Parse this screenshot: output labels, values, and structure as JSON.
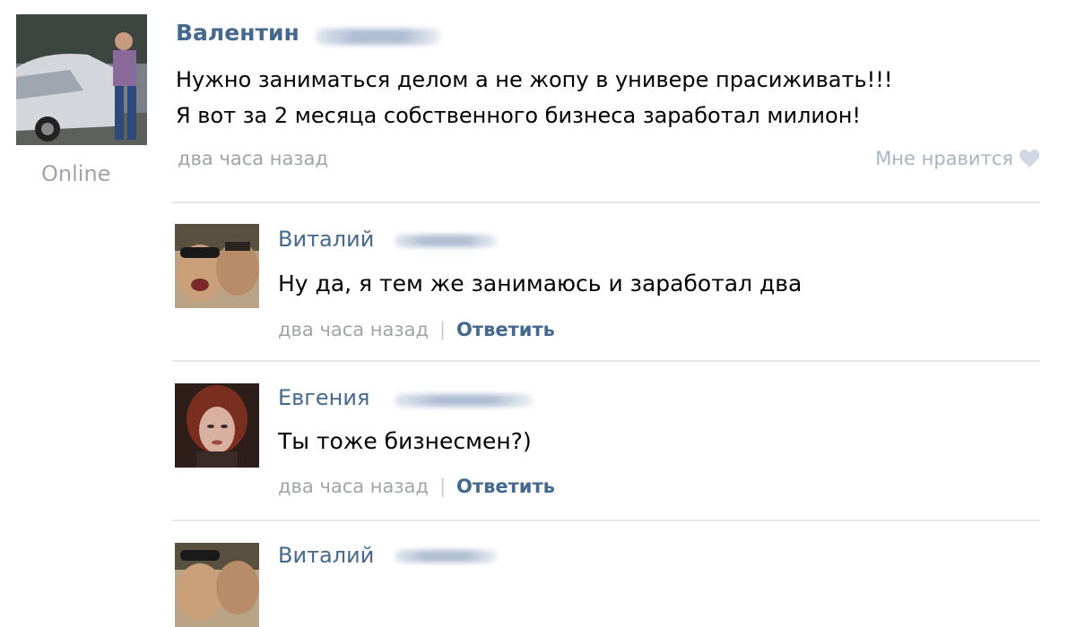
{
  "post": {
    "author": "Валентин",
    "status": "Online",
    "line1": "Нужно заниматься делом а не жопу в универе прасиживать!!!",
    "line2": "Я вот за 2 месяца собственного бизнеса заработал милион!",
    "time": "два часа назад",
    "like_label": "Мне нравится",
    "like_icon": "heart-icon"
  },
  "comments": [
    {
      "author": "Виталий",
      "text": "Ну да, я тем же занимаюсь и заработал два",
      "time": "два часа назад",
      "separator": "|",
      "reply_label": "Ответить"
    },
    {
      "author": "Евгения",
      "text": "Ты тоже бизнесмен?)",
      "time": "два часа назад",
      "separator": "|",
      "reply_label": "Ответить"
    },
    {
      "author": "Виталий"
    }
  ],
  "colors": {
    "link": "#45688e",
    "muted": "#a0a4aa",
    "like": "#a9b5c4",
    "separator": "#e4e8ed"
  }
}
